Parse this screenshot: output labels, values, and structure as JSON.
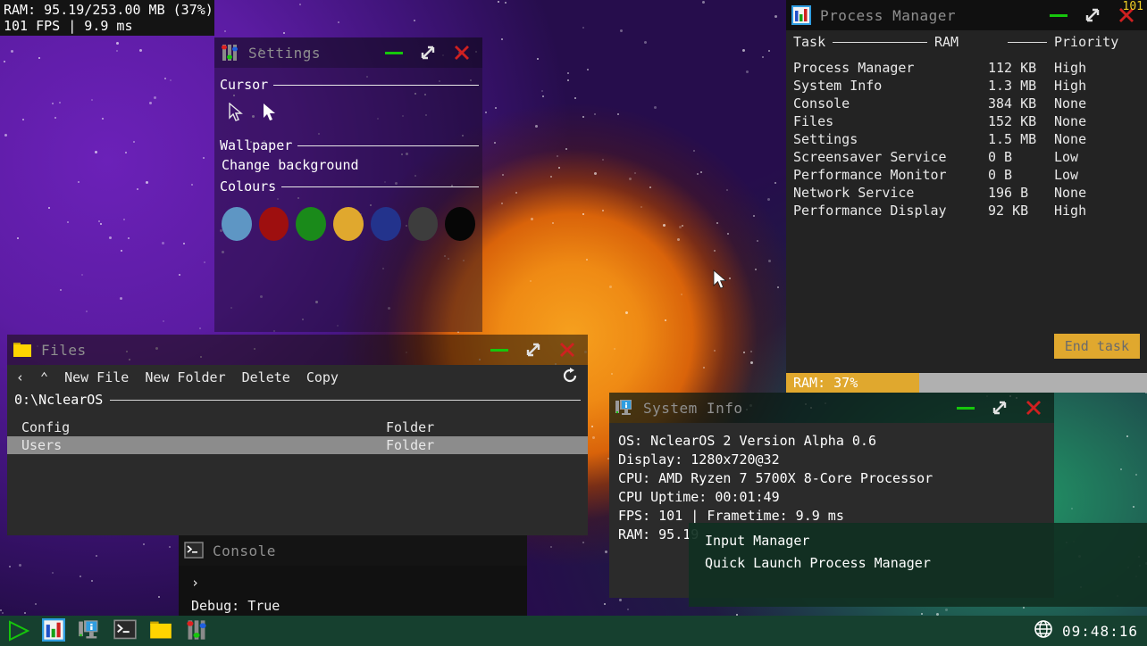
{
  "perf_overlay": {
    "ram_line": "RAM: 95.19/253.00 MB (37%)",
    "fps_line": "101 FPS | 9.9 ms",
    "fps_badge": "101"
  },
  "process_manager": {
    "title": "Process Manager",
    "icon": "chart-icon",
    "columns": {
      "task": "Task",
      "ram": "RAM",
      "priority": "Priority"
    },
    "rows": [
      {
        "task": "Process Manager",
        "ram": "112 KB",
        "priority": "High"
      },
      {
        "task": "System Info",
        "ram": "1.3 MB",
        "priority": "High"
      },
      {
        "task": "Console",
        "ram": "384 KB",
        "priority": "None"
      },
      {
        "task": "Files",
        "ram": "152 KB",
        "priority": "None"
      },
      {
        "task": "Settings",
        "ram": "1.5 MB",
        "priority": "None"
      },
      {
        "task": "Screensaver Service",
        "ram": "0 B",
        "priority": "Low"
      },
      {
        "task": "Performance Monitor",
        "ram": "0 B",
        "priority": "Low"
      },
      {
        "task": "Network Service",
        "ram": "196 B",
        "priority": "None"
      },
      {
        "task": "Performance Display",
        "ram": "92 KB",
        "priority": "High"
      }
    ],
    "end_task_label": "End task",
    "ram_bar_label": "RAM: 37%",
    "ram_bar_percent": 37,
    "accent_color": "#e0a82e"
  },
  "settings": {
    "title": "Settings",
    "icon": "sliders-icon",
    "sections": {
      "cursor": "Cursor",
      "wallpaper": "Wallpaper",
      "colours": "Colours"
    },
    "change_background_label": "Change background",
    "colour_swatches": [
      "#5e96c4",
      "#9e0f0f",
      "#1a8a1a",
      "#e0a82e",
      "#23338c",
      "#3d3d3d",
      "#060606"
    ]
  },
  "files": {
    "title": "Files",
    "icon": "folder-icon",
    "toolbar": {
      "back": "‹",
      "up": "⌃",
      "new_file": "New File",
      "new_folder": "New Folder",
      "delete": "Delete",
      "copy": "Copy",
      "refresh": "refresh-icon"
    },
    "path": "0:\\NclearOS",
    "entries": [
      {
        "name": "Config",
        "type": "Folder",
        "selected": false
      },
      {
        "name": "Users",
        "type": "Folder",
        "selected": true
      }
    ]
  },
  "system_info": {
    "title": "System Info",
    "icon": "monitor-info-icon",
    "lines": [
      "OS: NclearOS 2 Version Alpha 0.6",
      "Display: 1280x720@32",
      "CPU: AMD Ryzen 7 5700X 8-Core Processor",
      "CPU Uptime: 00:01:49",
      "FPS: 101 | Frametime: 9.9 ms",
      "RAM: 95.19"
    ]
  },
  "console": {
    "title": "Console",
    "icon": "terminal-icon",
    "prompt": "›",
    "output": "Debug: True"
  },
  "context_menu": {
    "items": [
      "Input Manager",
      "Quick Launch Process Manager"
    ]
  },
  "taskbar": {
    "start_label": "start-icon",
    "items": [
      {
        "name": "taskbar-process-manager",
        "icon": "chart-icon"
      },
      {
        "name": "taskbar-system-info",
        "icon": "monitor-info-icon"
      },
      {
        "name": "taskbar-console",
        "icon": "terminal-icon"
      },
      {
        "name": "taskbar-files",
        "icon": "folder-icon"
      },
      {
        "name": "taskbar-settings",
        "icon": "sliders-icon"
      }
    ],
    "network_icon": "globe-icon",
    "clock": "09:48:16",
    "background": "#16402f"
  },
  "window_controls": {
    "minimize": "minimize-icon",
    "maximize": "resize-icon",
    "close": "close-icon"
  }
}
